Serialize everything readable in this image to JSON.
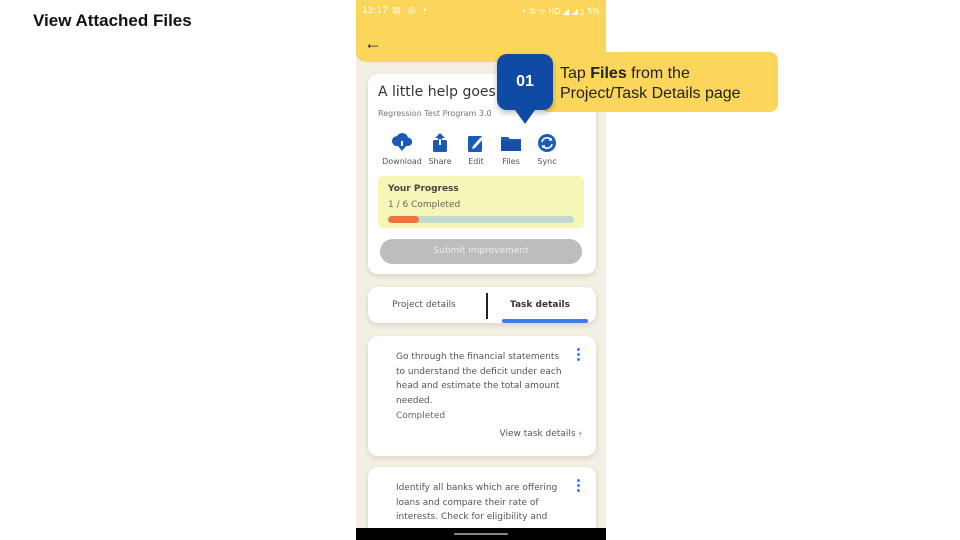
{
  "slide": {
    "title": "View Attached Files"
  },
  "status_bar": {
    "time": "12:17",
    "left_icons": "▤ ◎ •",
    "right_icons": "• ⇅ ᯤ HD ◢ ◢ ▯ 5%"
  },
  "header": {
    "back_icon": "arrow-left-icon",
    "back_glyph": "←"
  },
  "project": {
    "title": "A little help goes a",
    "subtitle": "Regression Test Program 3.0",
    "actions": [
      {
        "label": "Download",
        "icon": "cloud-download-icon"
      },
      {
        "label": "Share",
        "icon": "share-icon"
      },
      {
        "label": "Edit",
        "icon": "edit-icon"
      },
      {
        "label": "Files",
        "icon": "folder-icon"
      },
      {
        "label": "Sync",
        "icon": "sync-icon"
      }
    ],
    "progress": {
      "title": "Your Progress",
      "value_text": "1 / 6 Completed",
      "fraction": 0.1667
    },
    "submit_label": "Submit improvement"
  },
  "tabs": {
    "project_label": "Project details",
    "task_label": "Task details",
    "active": "Task details"
  },
  "tasks": [
    {
      "text": "Go through the financial statements to understand the deficit under each head and estimate the total amount needed.",
      "status": "Completed",
      "link": "View task details"
    },
    {
      "text": "Identify all banks which are offering loans and compare their rate of interests. Check for eligibility and"
    }
  ],
  "callout": {
    "step": "01",
    "text_prefix": "Tap ",
    "text_bold": "Files",
    "text_suffix": " from the Project/Task Details page"
  },
  "colors": {
    "header": "#fcd65a",
    "badge": "#0f4aa5",
    "accent_blue": "#1a5bb8",
    "tab_underline": "#3b7ee8",
    "progress_fill": "#f0723c"
  }
}
